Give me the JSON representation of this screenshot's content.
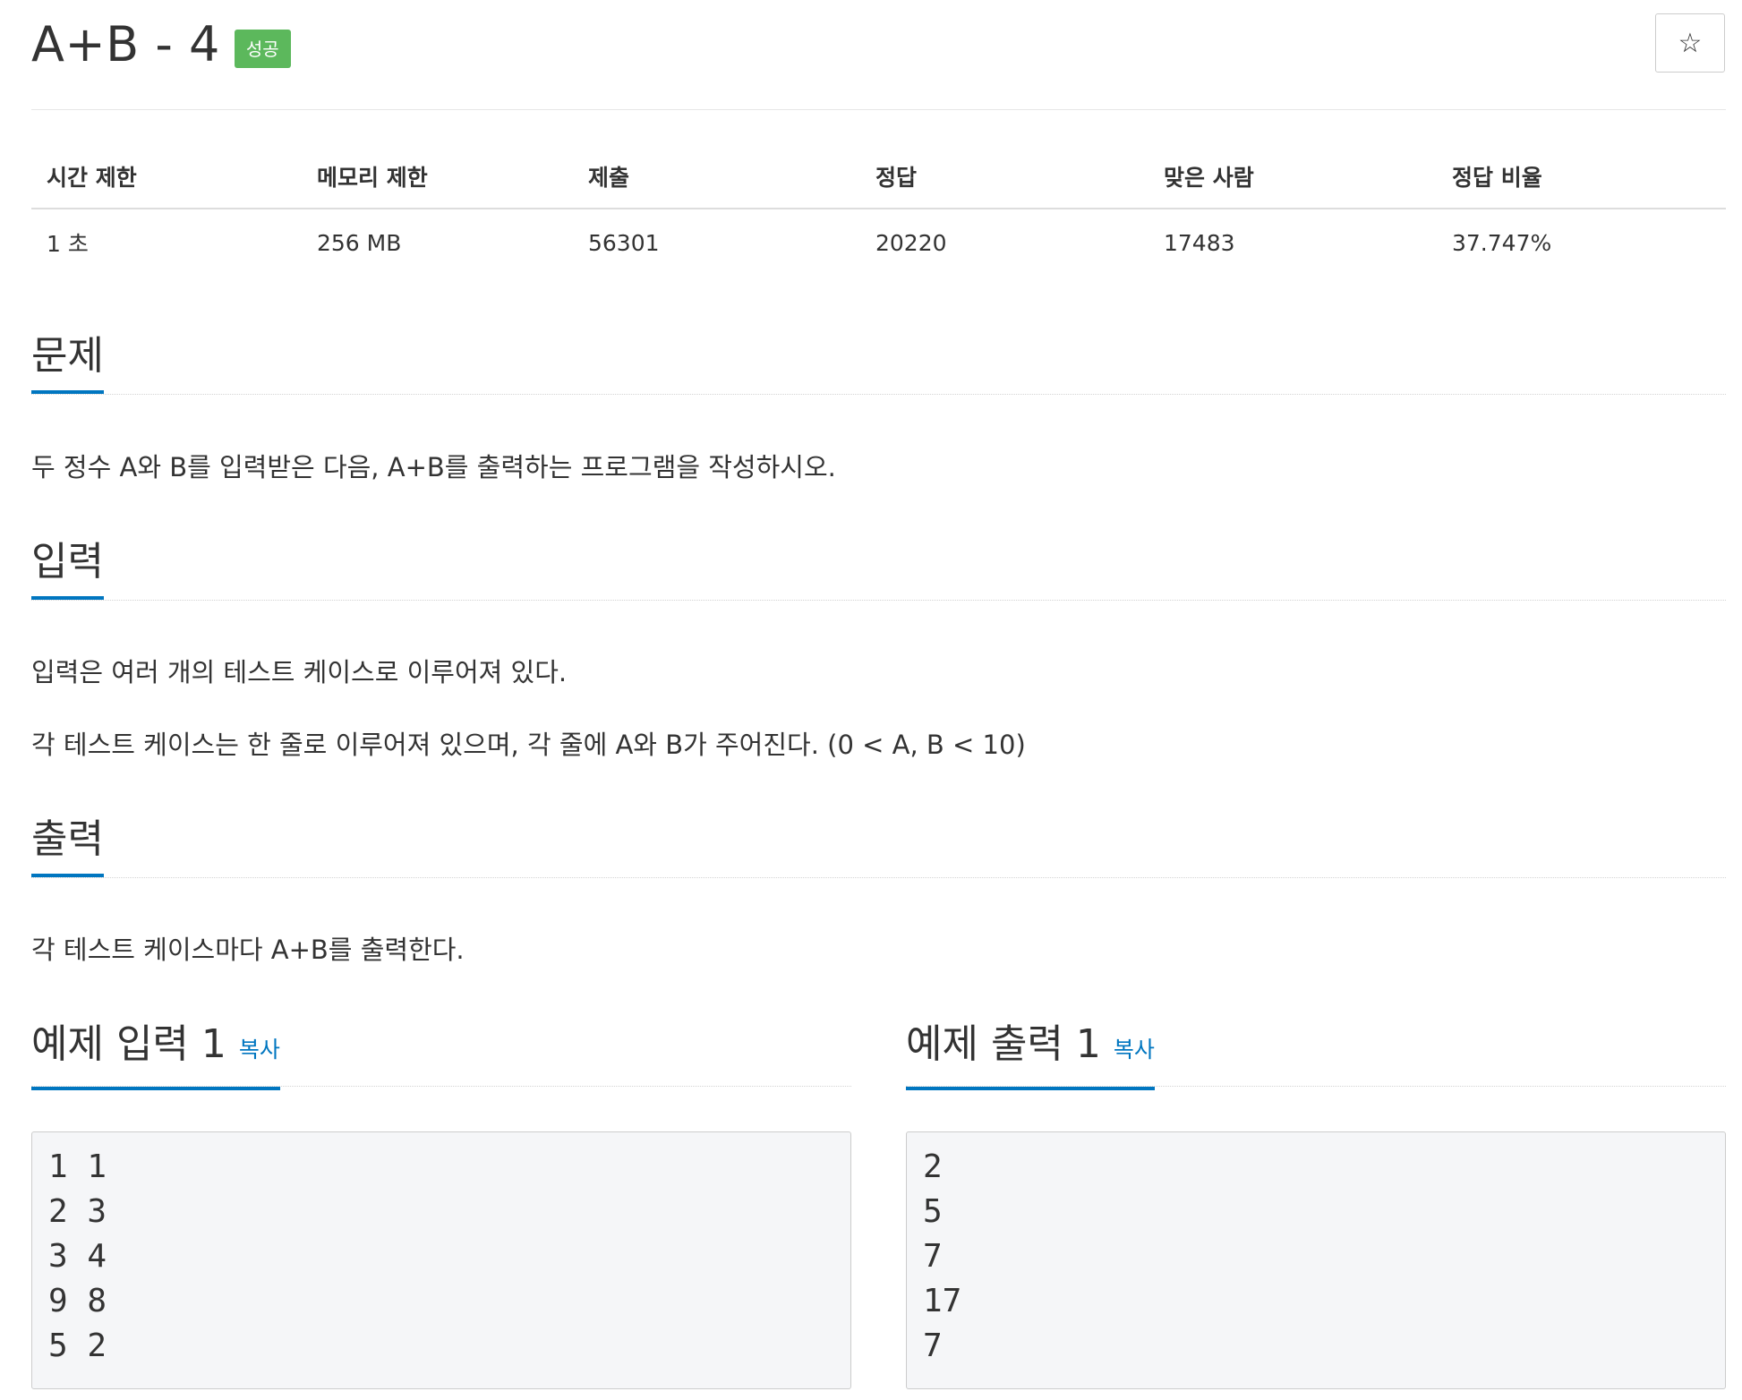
{
  "problem": {
    "title": "A+B - 4",
    "status_badge": "성공",
    "star_icon": "☆"
  },
  "info_table": {
    "headers": [
      "시간 제한",
      "메모리 제한",
      "제출",
      "정답",
      "맞은 사람",
      "정답 비율"
    ],
    "values": [
      "1 초",
      "256 MB",
      "56301",
      "20220",
      "17483",
      "37.747%"
    ]
  },
  "sections": {
    "problem": {
      "heading": "문제",
      "paragraphs": [
        "두 정수 A와 B를 입력받은 다음, A+B를 출력하는 프로그램을 작성하시오."
      ]
    },
    "input": {
      "heading": "입력",
      "paragraphs": [
        "입력은 여러 개의 테스트 케이스로 이루어져 있다.",
        "각 테스트 케이스는 한 줄로 이루어져 있으며, 각 줄에 A와 B가 주어진다. (0 < A, B < 10)"
      ]
    },
    "output": {
      "heading": "출력",
      "paragraphs": [
        "각 테스트 케이스마다 A+B를 출력한다."
      ]
    }
  },
  "samples": {
    "input": {
      "title": "예제 입력 1",
      "copy_label": "복사",
      "lines": [
        "1 1",
        "2 3",
        "3 4",
        "9 8",
        "5 2"
      ]
    },
    "output": {
      "title": "예제 출력 1",
      "copy_label": "복사",
      "lines": [
        "2",
        "5",
        "7",
        "17",
        "7"
      ]
    }
  },
  "colors": {
    "badge_success": "#5cb85c",
    "accent_blue": "#0076c0",
    "sample_bg": "#f5f6f8"
  }
}
